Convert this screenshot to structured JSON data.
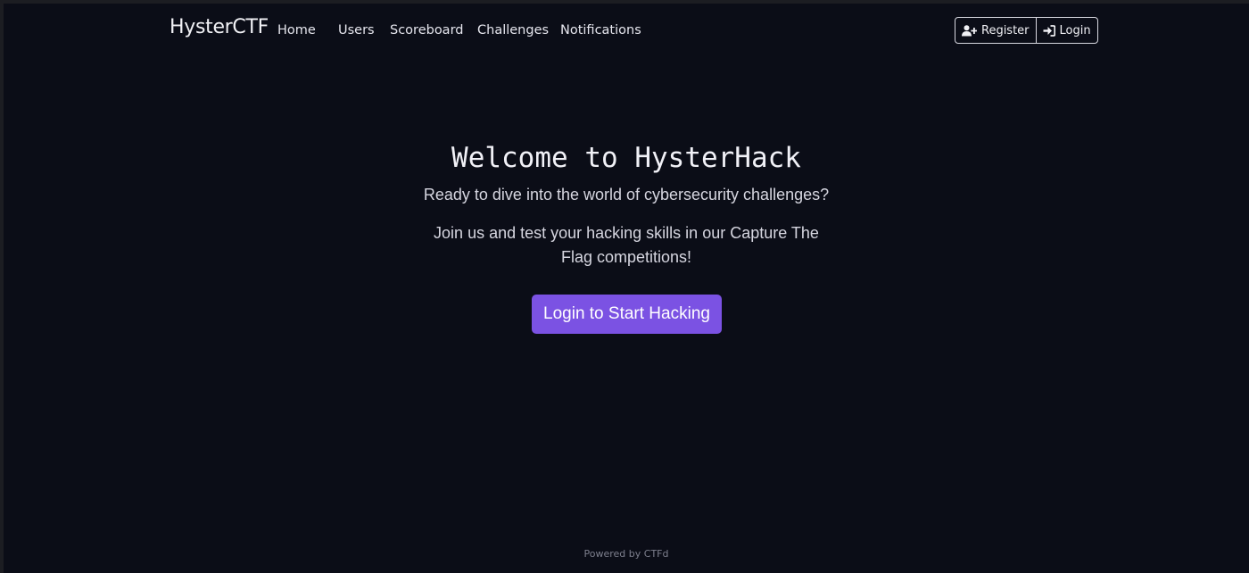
{
  "navbar": {
    "brand": "HysterCTF",
    "links": [
      {
        "label": "Home"
      },
      {
        "label": "Users"
      },
      {
        "label": "Scoreboard"
      },
      {
        "label": "Challenges"
      },
      {
        "label": "Notifications"
      }
    ],
    "register_label": "Register",
    "login_label": "Login",
    "register_icon": "user-plus-icon",
    "login_icon": "sign-in-icon"
  },
  "hero": {
    "title": "Welcome to HysterHack",
    "subtitle": "Ready to dive into the world of cybersecurity challenges?",
    "description": "Join us and test your hacking skills in our Capture The Flag competitions!",
    "cta_label": "Login to Start Hacking"
  },
  "footer": {
    "text": "Powered by CTFd"
  },
  "colors": {
    "background": "#0b0d17",
    "accent": "#7b52e3",
    "text": "#e9e9f0"
  }
}
